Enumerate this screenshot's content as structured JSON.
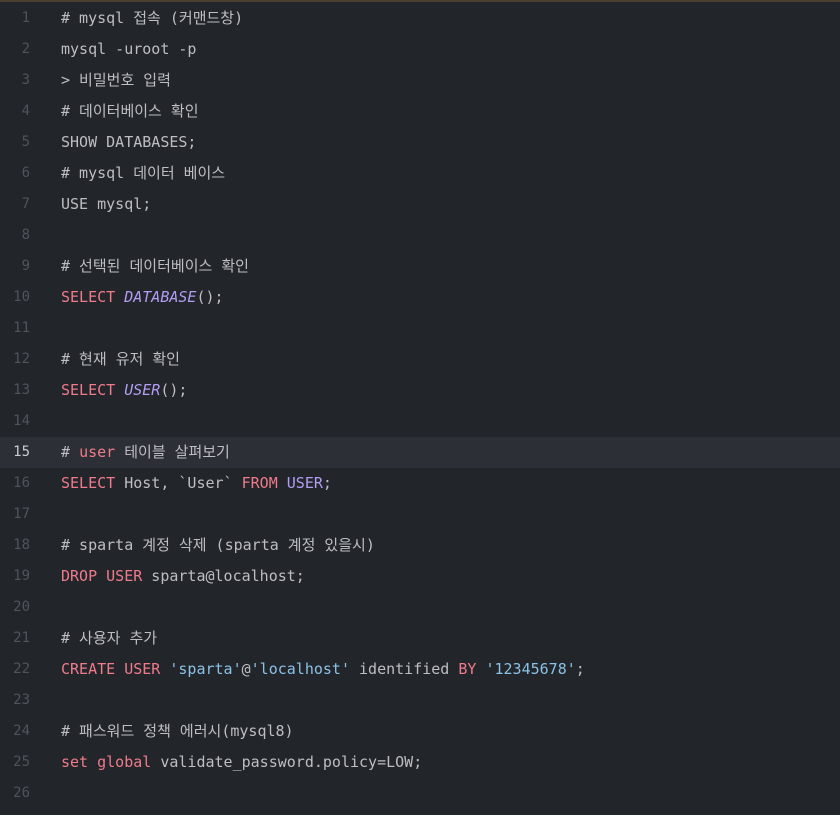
{
  "colors": {
    "background": "#22252a",
    "active_line": "#2c2f35",
    "line_number": "#4f545c",
    "active_line_number": "#c9ccd1",
    "text": "#bcbec4",
    "keyword": "#ef7b8b",
    "function": "#b39df3",
    "string": "#8ac2e6"
  },
  "editor": {
    "active_line": 15,
    "lines": [
      {
        "n": "1",
        "tokens": [
          {
            "t": "# mysql 접속 (커맨드창)",
            "c": "comment"
          }
        ]
      },
      {
        "n": "2",
        "tokens": [
          {
            "t": "mysql -uroot -p",
            "c": "plain"
          }
        ]
      },
      {
        "n": "3",
        "tokens": [
          {
            "t": "> 비밀번호 입력",
            "c": "plain"
          }
        ]
      },
      {
        "n": "4",
        "tokens": [
          {
            "t": "# 데이터베이스 확인",
            "c": "comment"
          }
        ]
      },
      {
        "n": "5",
        "tokens": [
          {
            "t": "SHOW DATABASES;",
            "c": "plain"
          }
        ]
      },
      {
        "n": "6",
        "tokens": [
          {
            "t": "# mysql 데이터 베이스",
            "c": "comment"
          }
        ]
      },
      {
        "n": "7",
        "tokens": [
          {
            "t": "USE mysql;",
            "c": "plain"
          }
        ]
      },
      {
        "n": "8",
        "tokens": []
      },
      {
        "n": "9",
        "tokens": [
          {
            "t": "# 선택된 데이터베이스 확인",
            "c": "comment"
          }
        ]
      },
      {
        "n": "10",
        "tokens": [
          {
            "t": "SELECT",
            "c": "keyword"
          },
          {
            "t": " ",
            "c": "plain"
          },
          {
            "t": "DATABASE",
            "c": "func"
          },
          {
            "t": "();",
            "c": "plain"
          }
        ]
      },
      {
        "n": "11",
        "tokens": []
      },
      {
        "n": "12",
        "tokens": [
          {
            "t": "# 현재 유저 확인",
            "c": "comment"
          }
        ]
      },
      {
        "n": "13",
        "tokens": [
          {
            "t": "SELECT",
            "c": "keyword"
          },
          {
            "t": " ",
            "c": "plain"
          },
          {
            "t": "USER",
            "c": "func"
          },
          {
            "t": "();",
            "c": "plain"
          }
        ]
      },
      {
        "n": "14",
        "tokens": []
      },
      {
        "n": "15",
        "tokens": [
          {
            "t": "# ",
            "c": "comment"
          },
          {
            "t": "user",
            "c": "keyword"
          },
          {
            "t": " 테이블 살펴보기",
            "c": "comment"
          }
        ]
      },
      {
        "n": "16",
        "tokens": [
          {
            "t": "SELECT",
            "c": "keyword"
          },
          {
            "t": " Host, `User` ",
            "c": "plain"
          },
          {
            "t": "FROM",
            "c": "keyword"
          },
          {
            "t": " ",
            "c": "plain"
          },
          {
            "t": "USER",
            "c": "ident"
          },
          {
            "t": ";",
            "c": "plain"
          }
        ]
      },
      {
        "n": "17",
        "tokens": []
      },
      {
        "n": "18",
        "tokens": [
          {
            "t": "# sparta 계정 삭제 (sparta 계정 있을시)",
            "c": "comment"
          }
        ]
      },
      {
        "n": "19",
        "tokens": [
          {
            "t": "DROP",
            "c": "keyword"
          },
          {
            "t": " ",
            "c": "plain"
          },
          {
            "t": "USER",
            "c": "keyword"
          },
          {
            "t": " sparta@localhost;",
            "c": "plain"
          }
        ]
      },
      {
        "n": "20",
        "tokens": []
      },
      {
        "n": "21",
        "tokens": [
          {
            "t": "# 사용자 추가",
            "c": "comment"
          }
        ]
      },
      {
        "n": "22",
        "tokens": [
          {
            "t": "CREATE",
            "c": "keyword"
          },
          {
            "t": " ",
            "c": "plain"
          },
          {
            "t": "USER",
            "c": "keyword"
          },
          {
            "t": " ",
            "c": "plain"
          },
          {
            "t": "'sparta'",
            "c": "string"
          },
          {
            "t": "@",
            "c": "plain"
          },
          {
            "t": "'localhost'",
            "c": "string"
          },
          {
            "t": " identified ",
            "c": "plain"
          },
          {
            "t": "BY",
            "c": "keyword"
          },
          {
            "t": " ",
            "c": "plain"
          },
          {
            "t": "'12345678'",
            "c": "string"
          },
          {
            "t": ";",
            "c": "plain"
          }
        ]
      },
      {
        "n": "23",
        "tokens": []
      },
      {
        "n": "24",
        "tokens": [
          {
            "t": "# 패스워드 정책 에러시(mysql8)",
            "c": "comment"
          }
        ]
      },
      {
        "n": "25",
        "tokens": [
          {
            "t": "set",
            "c": "keyword"
          },
          {
            "t": " ",
            "c": "plain"
          },
          {
            "t": "global",
            "c": "keyword"
          },
          {
            "t": " validate_password.policy=LOW;",
            "c": "plain"
          }
        ]
      },
      {
        "n": "26",
        "tokens": []
      }
    ]
  }
}
